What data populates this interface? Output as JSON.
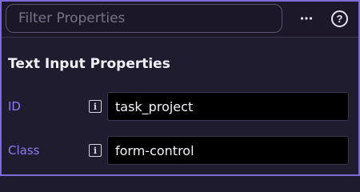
{
  "header": {
    "filter_placeholder": "Filter Properties",
    "more_label": "···",
    "help_label": "?"
  },
  "section": {
    "title": "Text Input Properties"
  },
  "properties": [
    {
      "label": "ID",
      "value": "task_project",
      "info_glyph": "i"
    },
    {
      "label": "Class",
      "value": "form-control",
      "info_glyph": "i"
    }
  ],
  "colors": {
    "accent": "#8b7cf0",
    "border": "#7f6bd6",
    "background": "#201c2f",
    "input_background": "#000000"
  },
  "icons": [
    "more-horizontal-icon",
    "help-circle-icon",
    "info-icon"
  ]
}
